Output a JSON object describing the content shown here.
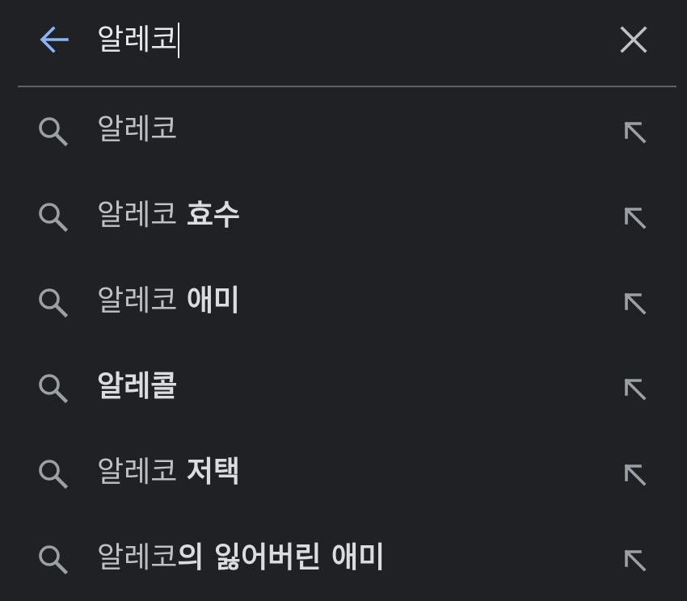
{
  "search": {
    "query": "알레코",
    "back_icon": "arrow-left-icon",
    "clear_icon": "close-icon",
    "accent_color": "#8ab4f8"
  },
  "suggestions": [
    {
      "prefix": "알레코",
      "completion": "",
      "icon": "search-icon",
      "action_icon": "arrow-up-left-icon"
    },
    {
      "prefix": "알레코 ",
      "completion": "효수",
      "icon": "search-icon",
      "action_icon": "arrow-up-left-icon"
    },
    {
      "prefix": "알레코 ",
      "completion": "애미",
      "icon": "search-icon",
      "action_icon": "arrow-up-left-icon"
    },
    {
      "prefix": "",
      "completion": "알레콜",
      "icon": "search-icon",
      "action_icon": "arrow-up-left-icon"
    },
    {
      "prefix": "알레코 ",
      "completion": "저택",
      "icon": "search-icon",
      "action_icon": "arrow-up-left-icon"
    },
    {
      "prefix": "알레코",
      "completion": "의 잃어버린 애미",
      "icon": "search-icon",
      "action_icon": "arrow-up-left-icon"
    }
  ]
}
